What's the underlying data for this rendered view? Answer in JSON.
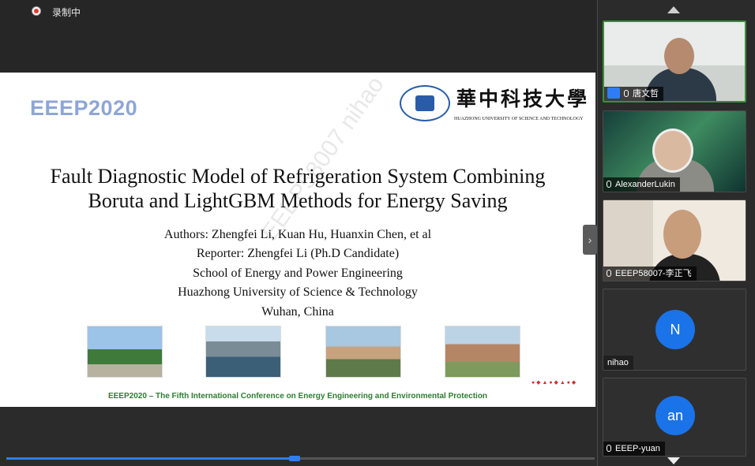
{
  "recording": {
    "label": "录制中"
  },
  "slide": {
    "conference_logo": "EEEP2020",
    "university_cn": "華中科技大學",
    "university_en": "HUAZHONG UNIVERSITY OF SCIENCE AND TECHNOLOGY",
    "watermark": "EEEP58007 nihao",
    "title_line1": "Fault Diagnostic Model of Refrigeration System Combining",
    "title_line2": "Boruta and LightGBM Methods for Energy Saving",
    "authors": "Authors: Zhengfei Li, Kuan Hu, Huanxin Chen, et al",
    "reporter": "Reporter: Zhengfei Li (Ph.D Candidate)",
    "school": "School of Energy and Power Engineering",
    "university": "Huazhong University of Science & Technology",
    "location": "Wuhan, China",
    "footer": "EEEP2020 – The Fifth International Conference on Energy Engineering and Environmental Protection"
  },
  "participants": [
    {
      "name": "唐文哲",
      "type": "video",
      "active_speaker": true
    },
    {
      "name": "AlexanderLukin",
      "type": "video"
    },
    {
      "name": "EEEP58007-李正飞",
      "type": "video"
    },
    {
      "name": "nihao",
      "type": "avatar",
      "initials": "N"
    },
    {
      "name": "EEEP-yuan",
      "type": "avatar",
      "initials": "an"
    }
  ],
  "playback": {
    "progress": 0.49
  },
  "colors": {
    "accent": "#2f7df6",
    "record_red": "#e23b2e",
    "active_border": "#3a8f3a",
    "footer_green": "#2e7d32"
  }
}
